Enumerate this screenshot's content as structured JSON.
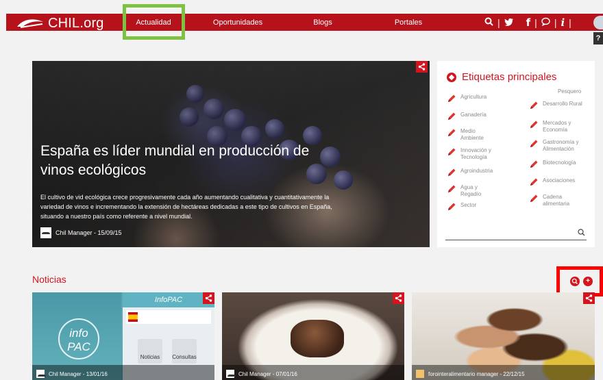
{
  "header": {
    "logo_text": "CHIL.org",
    "nav": [
      {
        "label": "Actualidad",
        "active": true
      },
      {
        "label": "Oportunidades",
        "active": false
      },
      {
        "label": "Blogs",
        "active": false
      },
      {
        "label": "Portales",
        "active": false
      }
    ],
    "help_label": "?",
    "icons": [
      "search-icon",
      "twitter-icon",
      "facebook-icon",
      "chat-icon",
      "info-icon",
      "avatar"
    ],
    "accent_color": "#b5121b",
    "highlight_color": "#7dc242"
  },
  "hero": {
    "title": "España es líder mundial en producción de vinos ecológicos",
    "description": "El cultivo de vid ecológica crece progresivamente cada año aumentando cualitativa y cuantitativamente la variedad de vinos e incrementando la extensión de hectáreas dedicadas a este tipo de cultivos en España, situando a nuestro país como referente a nivel mundial.",
    "author": "Chil Manager - 15/09/15"
  },
  "tags": {
    "title": "Etiquetas principales",
    "left": [
      "Agricultura",
      "Ganadería",
      "Medio Ambiente",
      "Innovación y Tecnología",
      "Agroindustria",
      "Agua y Regadío",
      "Sector"
    ],
    "right": [
      "Pesquero",
      "Desarrollo Rural",
      "Mercados y Economía",
      "Gastronomía y Alimentación",
      "Biotecnología",
      "Asociaciones",
      "Cadena alimentaria"
    ]
  },
  "noticias": {
    "title": "Noticias",
    "highlight_color": "#ff0000",
    "cards": [
      {
        "author": "Chil Manager - 13/01/16",
        "image_title": "InfoPAC",
        "app_name": "info PAC",
        "tile_labels": [
          "Noticias",
          "Consultas"
        ]
      },
      {
        "author": "Chil Manager - 07/01/16"
      },
      {
        "author": "forointeralimentario manager - 22/12/15"
      }
    ]
  }
}
